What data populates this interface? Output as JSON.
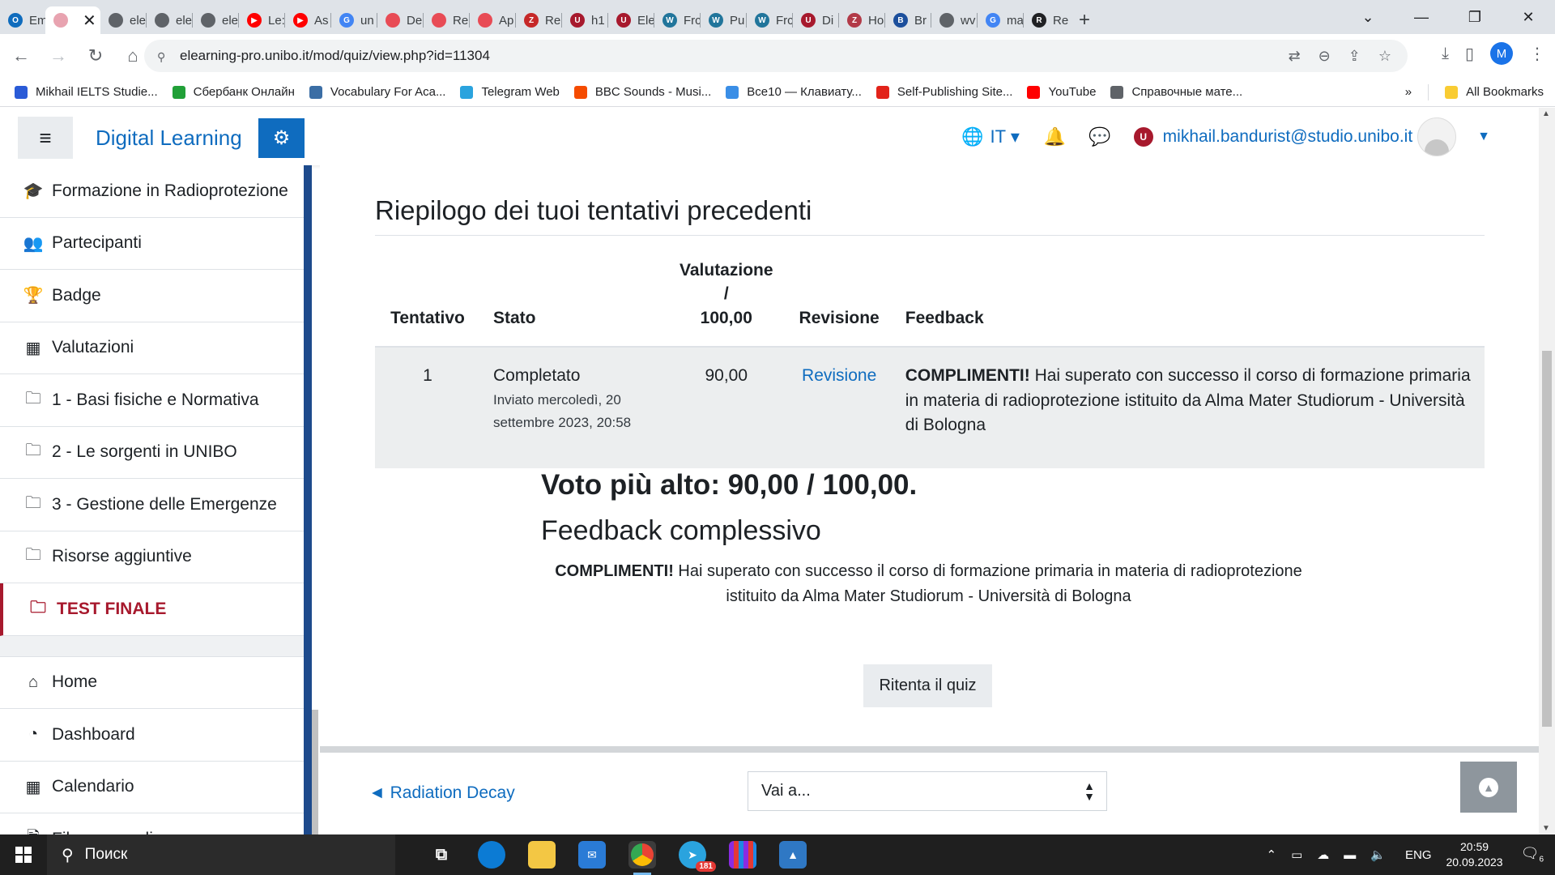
{
  "browser": {
    "tabs": [
      {
        "label": "Em",
        "color": "#0f6cbd",
        "glyph": "O"
      },
      {
        "label": "",
        "color": "#e8a3b0",
        "glyph": "",
        "active": true
      },
      {
        "label": "ele",
        "color": "#5f6368",
        "glyph": ""
      },
      {
        "label": "ele",
        "color": "#5f6368",
        "glyph": ""
      },
      {
        "label": "ele",
        "color": "#5f6368",
        "glyph": ""
      },
      {
        "label": "Le:",
        "color": "#ff0000",
        "glyph": "▶"
      },
      {
        "label": "As",
        "color": "#ff0000",
        "glyph": "▶"
      },
      {
        "label": "un",
        "color": "#4285f4",
        "glyph": "G"
      },
      {
        "label": "De",
        "color": "#e84b55",
        "glyph": ""
      },
      {
        "label": "Re",
        "color": "#e84b55",
        "glyph": ""
      },
      {
        "label": "Ap",
        "color": "#e84b55",
        "glyph": ""
      },
      {
        "label": "Re",
        "color": "#c62828",
        "glyph": "Z"
      },
      {
        "label": "h1",
        "color": "#a7192d",
        "glyph": "U"
      },
      {
        "label": "Ele",
        "color": "#a7192d",
        "glyph": "U"
      },
      {
        "label": "Frc",
        "color": "#21759b",
        "glyph": "W"
      },
      {
        "label": "Pu",
        "color": "#21759b",
        "glyph": "W"
      },
      {
        "label": "Frc",
        "color": "#21759b",
        "glyph": "W"
      },
      {
        "label": "Di",
        "color": "#a7192d",
        "glyph": "U"
      },
      {
        "label": "Ho",
        "color": "#b23a48",
        "glyph": "Z"
      },
      {
        "label": "Br",
        "color": "#1c4f9c",
        "glyph": "B"
      },
      {
        "label": "wv",
        "color": "#5f6368",
        "glyph": ""
      },
      {
        "label": "ma",
        "color": "#4285f4",
        "glyph": "G"
      },
      {
        "label": "Re",
        "color": "#202124",
        "glyph": "R"
      }
    ],
    "new_tab": "+",
    "url": "elearning-pro.unibo.it/mod/quiz/view.php?id=11304",
    "profile_initial": "M",
    "bookmarks": [
      {
        "label": "Mikhail IELTS Studie...",
        "color": "#2a5bd7"
      },
      {
        "label": "Сбербанк Онлайн",
        "color": "#21a038"
      },
      {
        "label": "Vocabulary For Aca...",
        "color": "#3b6ea5"
      },
      {
        "label": "Telegram Web",
        "color": "#2aa3de"
      },
      {
        "label": "BBC Sounds - Musi...",
        "color": "#f54b00"
      },
      {
        "label": "Все10 — Клавиату...",
        "color": "#3a8ee6"
      },
      {
        "label": "Self-Publishing Site...",
        "color": "#e2231a"
      },
      {
        "label": "YouTube",
        "color": "#ff0000"
      },
      {
        "label": "Справочные мате...",
        "color": "#5f6368"
      }
    ],
    "bookmarks_more": "»",
    "all_bookmarks": "All Bookmarks"
  },
  "header": {
    "site_name": "Digital Learning",
    "language": "IT",
    "user_email": "mikhail.bandurist@studio.unibo.it"
  },
  "sidebar": {
    "items": [
      {
        "label": "Formazione in Radioprotezione",
        "icon": "graduation-cap-icon",
        "glyph": "🎓"
      },
      {
        "label": "Partecipanti",
        "icon": "users-icon",
        "glyph": "👥"
      },
      {
        "label": "Badge",
        "icon": "trophy-icon",
        "glyph": "🏆"
      },
      {
        "label": "Valutazioni",
        "icon": "table-icon",
        "glyph": "▦"
      },
      {
        "label": "1 - Basi fisiche e Normativa",
        "icon": "folder-icon",
        "glyph": "🗀"
      },
      {
        "label": "2 - Le sorgenti in UNIBO",
        "icon": "folder-icon",
        "glyph": "🗀"
      },
      {
        "label": "3 - Gestione delle Emergenze",
        "icon": "folder-icon",
        "glyph": "🗀"
      },
      {
        "label": "Risorse aggiuntive",
        "icon": "folder-icon",
        "glyph": "🗀"
      },
      {
        "label": "TEST FINALE",
        "icon": "folder-icon",
        "glyph": "🗀",
        "active": true
      }
    ],
    "items2": [
      {
        "label": "Home",
        "icon": "home-icon",
        "glyph": "⌂"
      },
      {
        "label": "Dashboard",
        "icon": "dashboard-icon",
        "glyph": "◔"
      },
      {
        "label": "Calendario",
        "icon": "calendar-icon",
        "glyph": "▦"
      },
      {
        "label": "File personali",
        "icon": "file-icon",
        "glyph": "🗎"
      }
    ]
  },
  "summary": {
    "title": "Riepilogo dei tuoi tentativi precedenti",
    "columns": {
      "attempt": "Tentativo",
      "state": "Stato",
      "grade_line1": "Valutazione /",
      "grade_line2": "100,00",
      "review": "Revisione",
      "feedback": "Feedback"
    },
    "rows": [
      {
        "attempt": "1",
        "state": "Completato",
        "submitted": "Inviato mercoledì, 20 settembre 2023, 20:58",
        "grade": "90,00",
        "review_link": "Revisione",
        "feedback_bold": "COMPLIMENTI!",
        "feedback_text": " Hai superato con successo il corso di formazione primaria in materia di radioprotezione istituito da Alma Mater Studiorum - Università di Bologna"
      }
    ]
  },
  "result": {
    "best_grade": "Voto più alto: 90,00 / 100,00.",
    "feedback_heading": "Feedback complessivo",
    "feedback_bold": "COMPLIMENTI!",
    "feedback_text": " Hai superato con successo il corso di formazione primaria in materia di radioprotezione istituito da Alma Mater Studiorum - Università di Bologna",
    "retry_button": "Ritenta il quiz"
  },
  "activity_nav": {
    "prev_link": "◄ Radiation Decay",
    "jump_placeholder": "Vai a..."
  },
  "taskbar": {
    "search_label": "Поиск",
    "telegram_badge": "181",
    "language": "ENG",
    "time": "20:59",
    "date": "20.09.2023",
    "notifications": "6"
  }
}
